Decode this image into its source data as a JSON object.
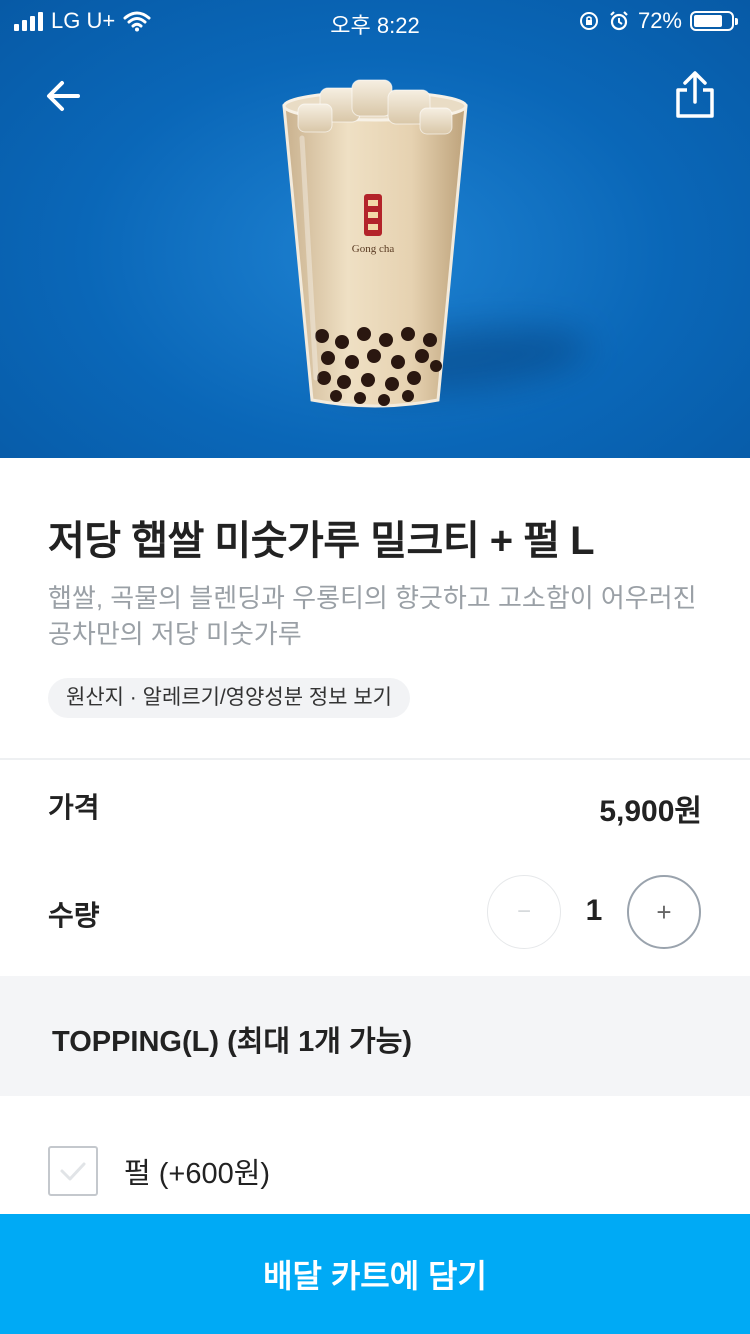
{
  "status_bar": {
    "carrier": "LG U+",
    "time": "오후 8:22",
    "battery": "72%"
  },
  "product": {
    "title": "저당 햅쌀 미숫가루 밀크티 + 펄 L",
    "description": "햅쌀, 곡물의 블렌딩과 우롱티의 향긋하고 고소함이 어우러진 공차만의 저당 미숫가루",
    "info_link": "원산지 · 알레르기/영양성분 정보 보기",
    "cup_logo": "Gong cha"
  },
  "price": {
    "label": "가격",
    "value": "5,900원"
  },
  "quantity": {
    "label": "수량",
    "value": "1",
    "minus": "−",
    "plus": "+"
  },
  "topping": {
    "title": "TOPPING(L) (최대 1개 가능)",
    "options": [
      {
        "label": "펄 (+600원)",
        "checked": false
      }
    ]
  },
  "cta_label": "배달 카트에 담기",
  "colors": {
    "hero_blue": "#0a67b8",
    "cta": "#00aaf5"
  }
}
